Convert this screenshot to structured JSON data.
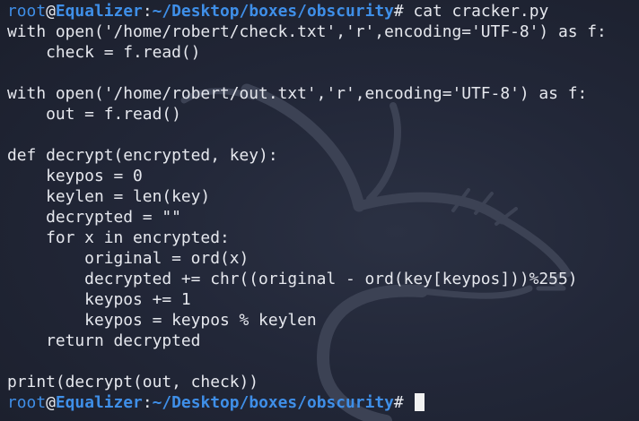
{
  "theme": {
    "background": "#1b1f2c",
    "prompt_color": "#3f8fe8",
    "text_color": "#e6e8ee"
  },
  "prompt": {
    "user": "root",
    "at": "@",
    "host": "Equalizer",
    "colon": ":",
    "path": "~/Desktop/boxes/obscurity",
    "symbol": "#"
  },
  "command": "cat cracker.py",
  "output_lines": [
    "with open('/home/robert/check.txt','r',encoding='UTF-8') as f:",
    "    check = f.read()",
    "",
    "with open('/home/robert/out.txt','r',encoding='UTF-8') as f:",
    "    out = f.read()",
    "",
    "def decrypt(encrypted, key):",
    "    keypos = 0",
    "    keylen = len(key)",
    "    decrypted = \"\"",
    "    for x in encrypted:",
    "        original = ord(x)",
    "        decrypted += chr((original - ord(key[keypos]))%255)",
    "        keypos += 1",
    "        keypos = keypos % keylen",
    "    return decrypted",
    "",
    "print(decrypt(out, check))"
  ],
  "background_logo": "kali-dragon-icon"
}
